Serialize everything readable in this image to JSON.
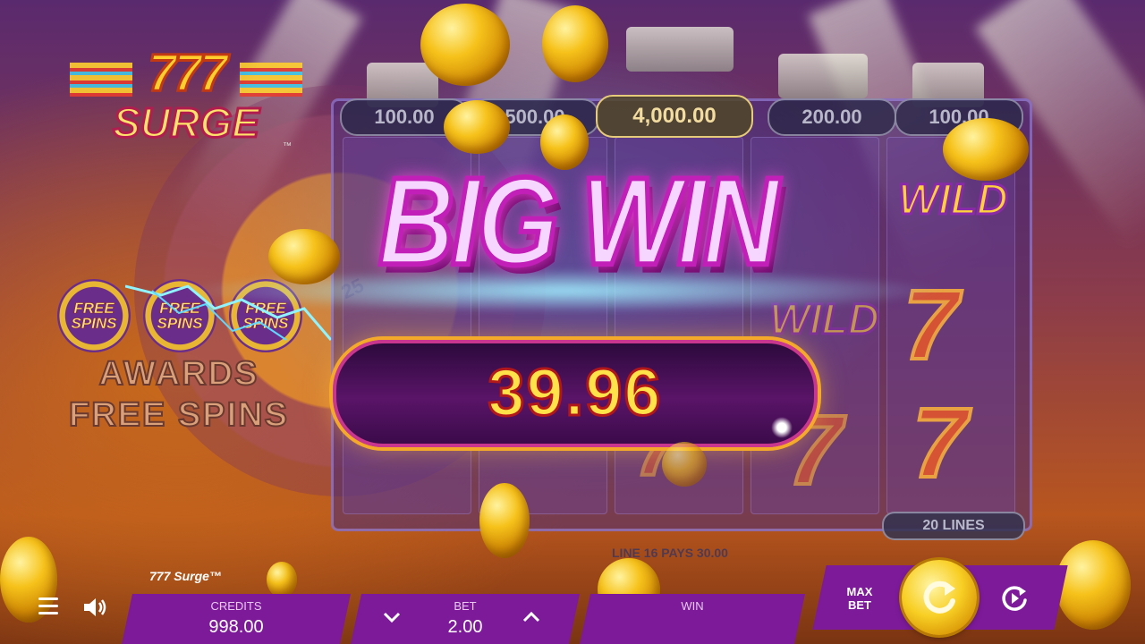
{
  "game": {
    "title": "777 Surge™"
  },
  "logo": {
    "line1": "777",
    "line2": "SURGE",
    "tm": "™"
  },
  "wheel": {
    "visible_number": "25"
  },
  "feature": {
    "coin_text": [
      "FREE",
      "SPINS"
    ],
    "awards_line1": "AWARDS",
    "awards_line2": "FREE SPINS"
  },
  "jackpots": [
    "100.00",
    "500.00",
    "4,000.00",
    "200.00",
    "100.00"
  ],
  "reel_symbols": {
    "wild": "WILD",
    "seven": "7"
  },
  "big_win": {
    "heading": "BIG WIN",
    "amount": "39.96"
  },
  "lines_badge": "20 LINES",
  "payline_message": "LINE 16 PAYS 30.00",
  "bottom_bar": {
    "credits_label": "CREDITS",
    "credits_value": "998.00",
    "bet_label": "BET",
    "bet_value": "2.00",
    "win_label": "WIN",
    "win_value": "",
    "max_bet_label": "MAX BET"
  },
  "icons": {
    "menu": "hamburger-menu-icon",
    "sound": "speaker-icon",
    "bet_down": "chevron-down-icon",
    "bet_up": "chevron-up-icon",
    "spin": "spin-arrow-icon",
    "autoplay": "autoplay-icon"
  },
  "colors": {
    "panel": "#7d1a99",
    "spin_gold": "#f8cf24",
    "win_amount": "#ffe24a",
    "big_win_stroke": "#c21fb8"
  }
}
